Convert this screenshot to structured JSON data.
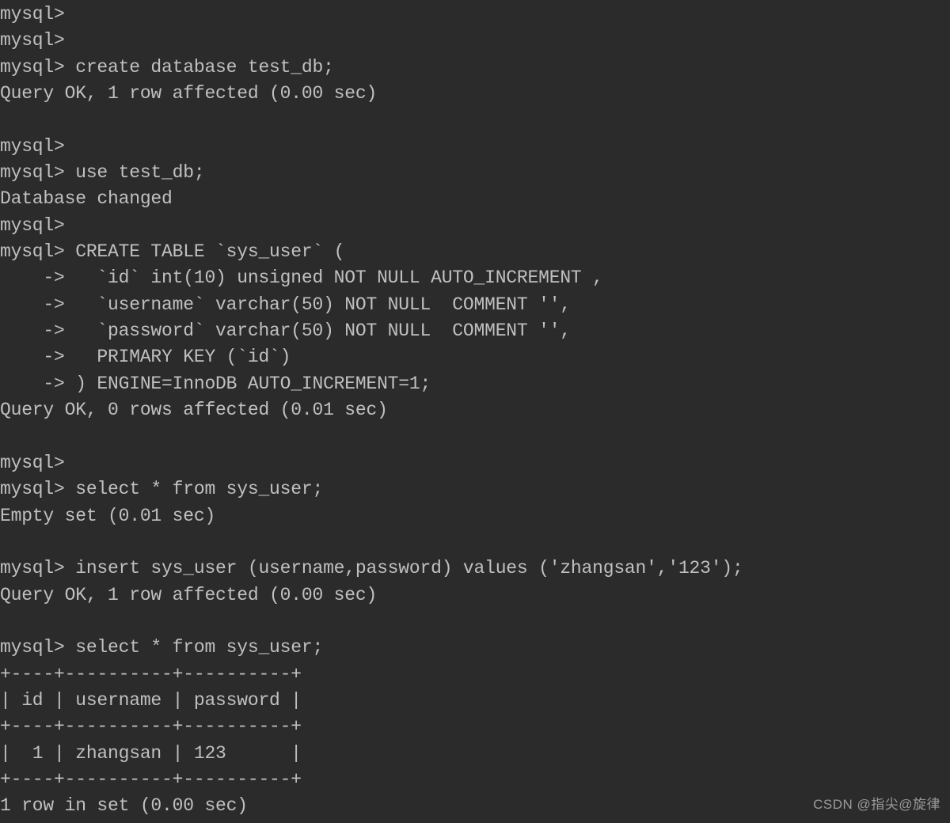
{
  "terminal": {
    "lines": [
      "mysql>",
      "mysql>",
      "mysql> create database test_db;",
      "Query OK, 1 row affected (0.00 sec)",
      "",
      "mysql>",
      "mysql> use test_db;",
      "Database changed",
      "mysql>",
      "mysql> CREATE TABLE `sys_user` (",
      "    ->   `id` int(10) unsigned NOT NULL AUTO_INCREMENT ,",
      "    ->   `username` varchar(50) NOT NULL  COMMENT '',",
      "    ->   `password` varchar(50) NOT NULL  COMMENT '',",
      "    ->   PRIMARY KEY (`id`)",
      "    -> ) ENGINE=InnoDB AUTO_INCREMENT=1;",
      "Query OK, 0 rows affected (0.01 sec)",
      "",
      "mysql>",
      "mysql> select * from sys_user;",
      "Empty set (0.01 sec)",
      "",
      "mysql> insert sys_user (username,password) values ('zhangsan','123');",
      "Query OK, 1 row affected (0.00 sec)",
      "",
      "mysql> select * from sys_user;",
      "+----+----------+----------+",
      "| id | username | password |",
      "+----+----------+----------+",
      "|  1 | zhangsan | 123      |",
      "+----+----------+----------+",
      "1 row in set (0.00 sec)"
    ]
  },
  "watermark": {
    "text": "CSDN @指尖@旋律"
  }
}
